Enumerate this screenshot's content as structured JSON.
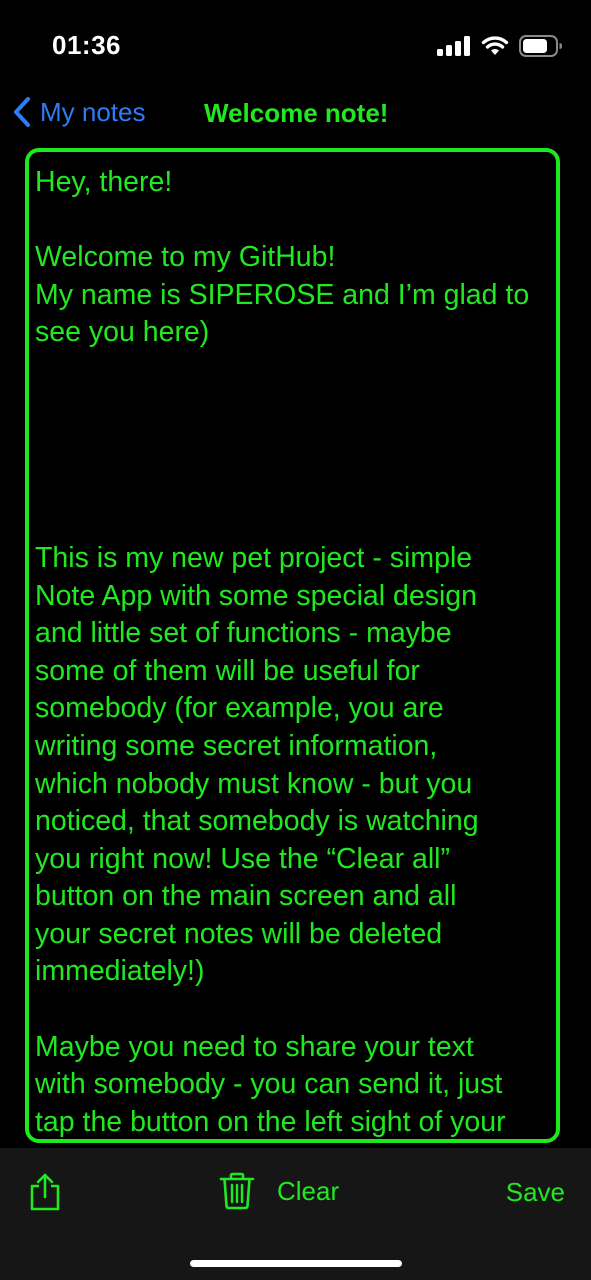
{
  "status_bar": {
    "time": "01:36",
    "icons": [
      "cellular-signal-icon",
      "wifi-icon",
      "battery-icon"
    ]
  },
  "nav": {
    "back_label": "My notes",
    "title": "Welcome note!"
  },
  "note": {
    "text": "Hey, there!\n\nWelcome to my GitHub!\nMy name is SIPEROSE and I’m glad to\nsee you here)\n\n\n\n\n\nThis is my new pet project - simple\nNote App with some special design\nand little set of functions - maybe\nsome of them will be useful for\nsomebody (for example, you are\nwriting some secret information,\nwhich nobody must know - but you\nnoticed, that somebody is watching\nyou right now! Use the “Clear all”\nbutton on the main screen and all\nyour secret notes will be deleted\nimmediately!)\n\nMaybe you need to share your text\nwith somebody - you can send it, just\ntap the button on the left sight of your"
  },
  "toolbar": {
    "share_icon": "share-icon",
    "clear_icon": "trash-icon",
    "clear_label": "Clear",
    "save_label": "Save"
  },
  "colors": {
    "accent_green": "#22e822",
    "border_green": "#1ee81e",
    "link_blue": "#2f7cf6",
    "background": "#000000",
    "toolbar_background": "#161616"
  }
}
